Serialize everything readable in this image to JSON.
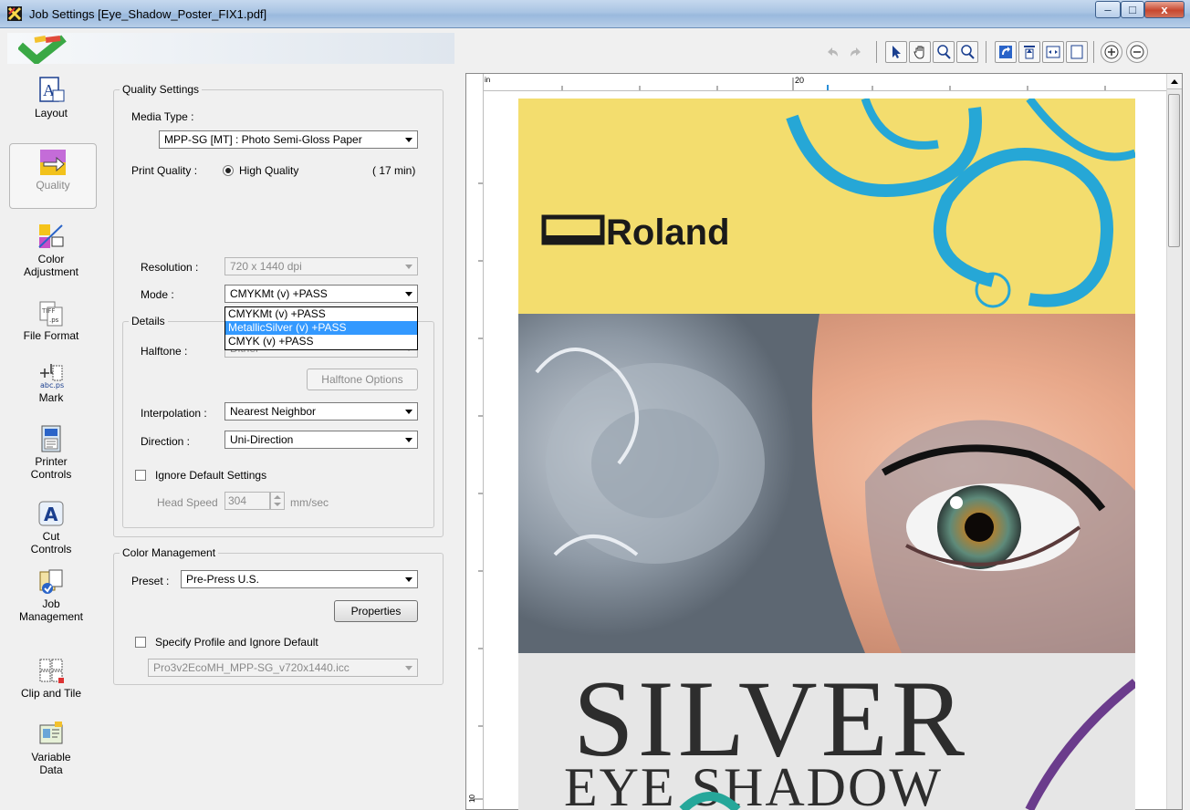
{
  "window": {
    "title": "Job Settings [Eye_Shadow_Poster_FIX1.pdf]"
  },
  "sidebar": {
    "items": [
      {
        "label": "Layout",
        "icon": "layout-icon"
      },
      {
        "label": "Quality",
        "icon": "quality-icon",
        "selected": true
      },
      {
        "label": "Color\nAdjustment",
        "icon": "color-adjustment-icon"
      },
      {
        "label": "File Format",
        "icon": "file-format-icon"
      },
      {
        "label": "Mark",
        "icon": "mark-icon"
      },
      {
        "label": "Printer\nControls",
        "icon": "printer-controls-icon"
      },
      {
        "label": "Cut\nControls",
        "icon": "cut-controls-icon"
      },
      {
        "label": "Job\nManagement",
        "icon": "job-management-icon"
      },
      {
        "label": "Clip and Tile",
        "icon": "clip-and-tile-icon"
      },
      {
        "label": "Variable\nData",
        "icon": "variable-data-icon"
      }
    ]
  },
  "quality": {
    "group_title": "Quality Settings",
    "media_type_label": "Media Type :",
    "media_type_value": "MPP-SG [MT] : Photo Semi-Gloss Paper",
    "print_quality_label": "Print Quality :",
    "print_quality_value": "High Quality",
    "print_quality_time": "( 17 min)",
    "resolution_label": "Resolution :",
    "resolution_value": "720 x 1440 dpi",
    "mode_label": "Mode :",
    "mode_value": "CMYKMt (v) +PASS",
    "mode_options": [
      "CMYKMt (v) +PASS",
      "MetallicSilver (v) +PASS",
      "CMYK (v) +PASS"
    ],
    "mode_highlighted": "MetallicSilver (v) +PASS",
    "details_title": "Details",
    "halftone_label": "Halftone :",
    "halftone_value": "Dither",
    "halftone_options_button": "Halftone Options",
    "interpolation_label": "Interpolation :",
    "interpolation_value": "Nearest Neighbor",
    "direction_label": "Direction :",
    "direction_value": "Uni-Direction",
    "ignore_default_label": "Ignore Default Settings",
    "head_speed_label": "Head Speed",
    "head_speed_value": "304",
    "head_speed_unit": "mm/sec"
  },
  "color_management": {
    "group_title": "Color Management",
    "preset_label": "Preset :",
    "preset_value": "Pre-Press U.S.",
    "properties_button": "Properties",
    "specify_profile_label": "Specify Profile and Ignore Default",
    "profile_value": "Pro3v2EcoMH_MPP-SG_v720x1440.icc"
  },
  "ruler": {
    "unit": "in",
    "top_mark": "20",
    "left_mark": "10"
  },
  "poster": {
    "brand": "Roland",
    "headline": "SILVER",
    "subline": "EYE SHADOW"
  },
  "colors": {
    "poster_yellow": "#f3dd6e",
    "poster_cyan": "#26a7d6",
    "selection_blue": "#3399ff",
    "purple_swirl": "#6b3c8c"
  }
}
